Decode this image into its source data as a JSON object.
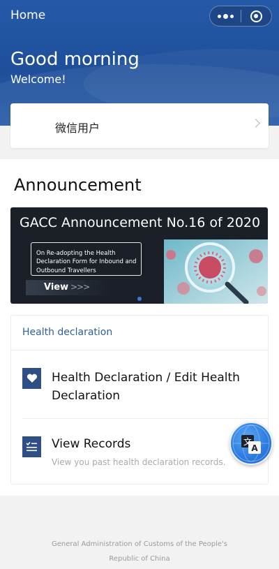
{
  "nav": {
    "title": "Home"
  },
  "greeting": {
    "title": "Good morning",
    "subtitle": "Welcome!"
  },
  "user": {
    "name": "微信用户"
  },
  "announcement": {
    "title": "Announcement",
    "banner": {
      "title": "GACC Announcement No.16 of 2020",
      "description": "On Re-adopting the Health Declaration Form for Inbound and Outbound Travellers",
      "view_label": "View",
      "view_arrows": ">>>"
    }
  },
  "health": {
    "section_title": "Health declaration",
    "items": [
      {
        "label": "Health Declaration / Edit Health Declaration",
        "icon": "heart-icon"
      },
      {
        "label": "View Records",
        "subtitle": "View you past health declaration records.",
        "icon": "records-icon"
      }
    ]
  },
  "footer": {
    "text": "General Administration of Customs of the People's Republic of China"
  },
  "colors": {
    "brand": "#2559a8",
    "section_title": "#2d5fa3",
    "icon_bg": "#2d4f86"
  }
}
